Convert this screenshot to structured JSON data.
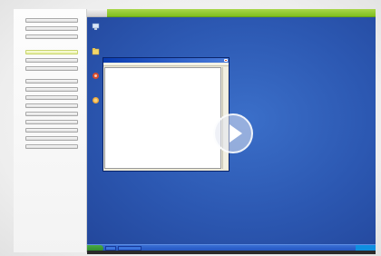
{
  "sidebar": {
    "items": [
      {
        "label": "",
        "active": false
      },
      {
        "label": "",
        "active": false
      },
      {
        "label": "",
        "active": false
      },
      {
        "label": "",
        "active": true
      },
      {
        "label": "",
        "active": false
      },
      {
        "label": "",
        "active": false
      },
      {
        "label": "",
        "active": false
      },
      {
        "label": "",
        "active": false
      },
      {
        "label": "",
        "active": false
      },
      {
        "label": "",
        "active": false
      },
      {
        "label": "",
        "active": false
      },
      {
        "label": "",
        "active": false
      },
      {
        "label": "",
        "active": false
      },
      {
        "label": "",
        "active": false
      },
      {
        "label": "",
        "active": false
      }
    ]
  },
  "header": {
    "title": ""
  },
  "desktop": {
    "icons": [
      {
        "name": "my-computer-icon",
        "label": ""
      },
      {
        "name": "my-documents-icon",
        "label": ""
      },
      {
        "name": "network-icon",
        "label": ""
      },
      {
        "name": "browser-icon",
        "label": ""
      }
    ]
  },
  "notepad": {
    "title": "",
    "menu": ""
  },
  "taskbar": {
    "start_label": "",
    "items": [
      "",
      ""
    ],
    "clock": ""
  },
  "overlay": {
    "icon": "play-icon"
  },
  "colors": {
    "accent_green": "#8bc72b",
    "desktop_blue": "#2c58b2",
    "taskbar_blue": "#2456c2",
    "start_green": "#3a9a35"
  }
}
